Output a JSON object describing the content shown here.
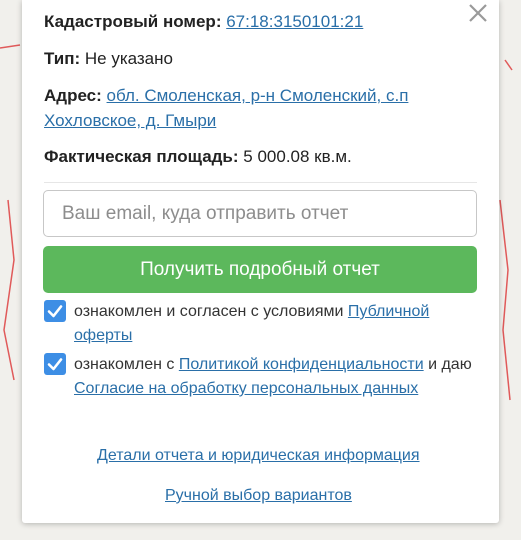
{
  "info": {
    "cadastral_label": "Кадастровый номер:",
    "cadastral_value": "67:18:3150101:21",
    "type_label": "Тип:",
    "type_value": "Не указано",
    "address_label": "Адрес:",
    "address_value": "обл. Смоленская, р-н Смоленский, с.п Хохловское, д. Гмыри",
    "area_label": "Фактическая площадь:",
    "area_value": "5 000.08 кв.м."
  },
  "form": {
    "email_placeholder": "Ваш email, куда отправить отчет",
    "submit_label": "Получить подробный отчет"
  },
  "consents": {
    "offer_text": "ознакомлен и согласен с условиями ",
    "offer_link": "Публичной оферты",
    "privacy_text_1": "ознакомлен с ",
    "privacy_link": "Политикой конфиденциальности",
    "privacy_text_2": " и даю ",
    "processing_link": "Согласие на обработку персональных данных"
  },
  "links": {
    "report_details": "Детали отчета и юридическая информация",
    "manual_selection": "Ручной выбор вариантов"
  },
  "colors": {
    "link": "#2a6fa8",
    "button": "#5cb85c",
    "checkbox": "#3d8ee5"
  }
}
